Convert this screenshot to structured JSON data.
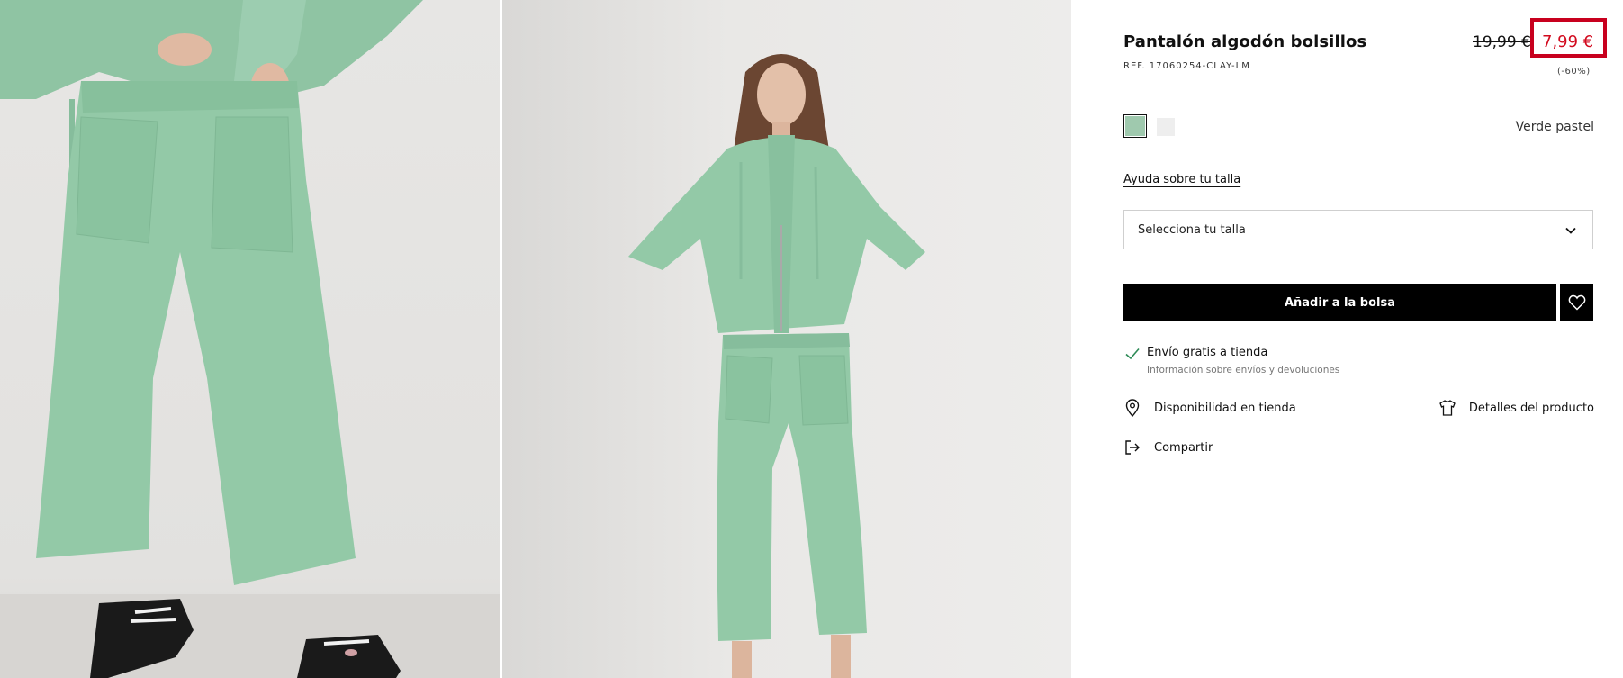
{
  "product": {
    "title": "Pantalón algodón bolsillos",
    "ref": "REF. 17060254-CLAY-LM"
  },
  "price": {
    "original": "19,99 €",
    "sale": "7,99 €",
    "discount": "(-60%)",
    "sale_color": "#d20a1e",
    "highlight_color": "#c8001e"
  },
  "colors": {
    "selected_name": "Verde pastel",
    "swatches": [
      {
        "name": "green-swatch",
        "hex": "#9fc9ae",
        "selected": true
      },
      {
        "name": "grey-swatch",
        "hex": "#eeeeee",
        "selected": false
      }
    ]
  },
  "size": {
    "help_link": "Ayuda sobre tu talla",
    "select_label": "Selecciona tu talla"
  },
  "actions": {
    "add_to_bag": "Añadir a la bolsa",
    "favorite_icon": "heart-icon"
  },
  "shipping": {
    "title": "Envío gratis a tienda",
    "info_link": "Información sobre envíos y devoluciones",
    "icon": "check-icon"
  },
  "links": {
    "availability": "Disponibilidad en tienda",
    "details": "Detalles del producto",
    "share": "Compartir"
  },
  "gallery": {
    "item_color": "#93c9a7",
    "images": [
      "pants-closeup-photo",
      "model-full-body-photo"
    ]
  }
}
